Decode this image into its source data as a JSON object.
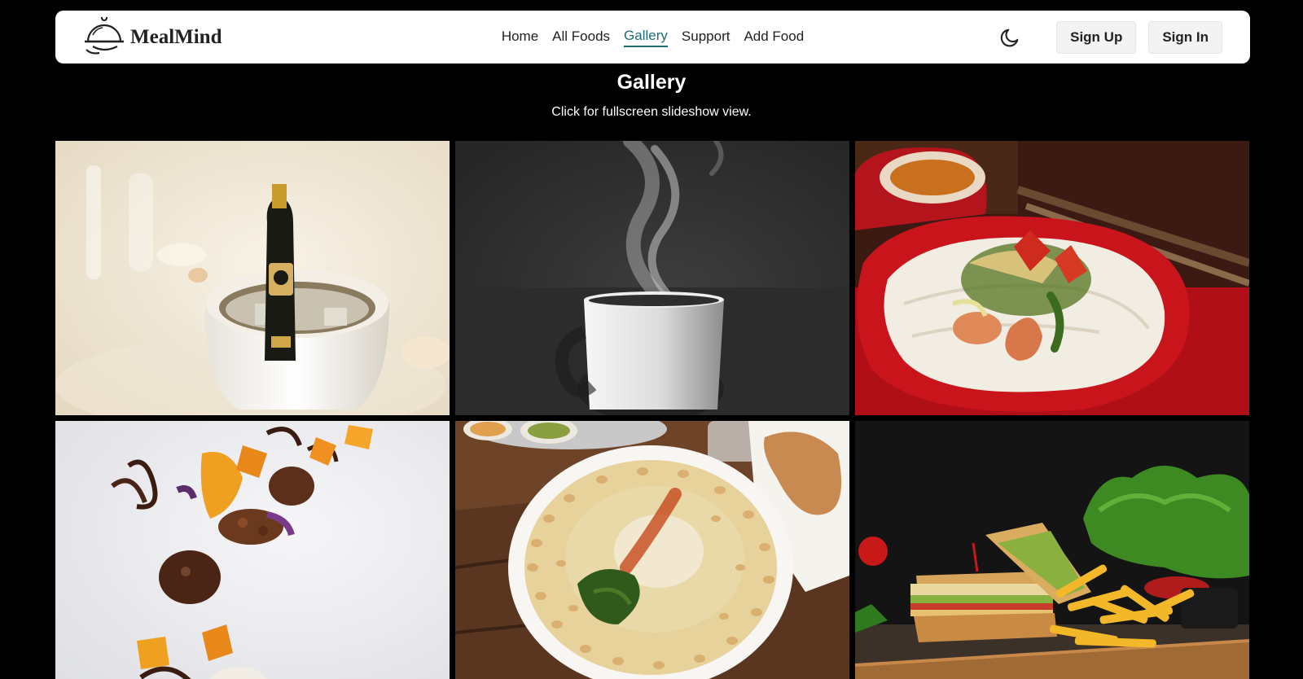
{
  "app": {
    "brand_name": "MealMind",
    "logo_icon": "cloche-icon"
  },
  "nav": {
    "links": [
      {
        "label": "Home"
      },
      {
        "label": "All Foods"
      },
      {
        "label": "Gallery",
        "active": true
      },
      {
        "label": "Support"
      },
      {
        "label": "Add Food"
      }
    ],
    "theme_toggle_icon": "moon-icon",
    "signup_label": "Sign Up",
    "signin_label": "Sign In"
  },
  "page": {
    "title": "Gallery",
    "subtitle": "Click for fullscreen slideshow view."
  },
  "gallery": {
    "images": [
      {
        "subject": "champagne-bucket"
      },
      {
        "subject": "steaming-mug"
      },
      {
        "subject": "shrimp-noodle-plate"
      },
      {
        "subject": "plated-dessert"
      },
      {
        "subject": "hummus-plate"
      },
      {
        "subject": "sandwich-fries"
      }
    ]
  },
  "colors": {
    "accent": "#1c6e73",
    "background": "#000000",
    "navbar": "#ffffff"
  }
}
